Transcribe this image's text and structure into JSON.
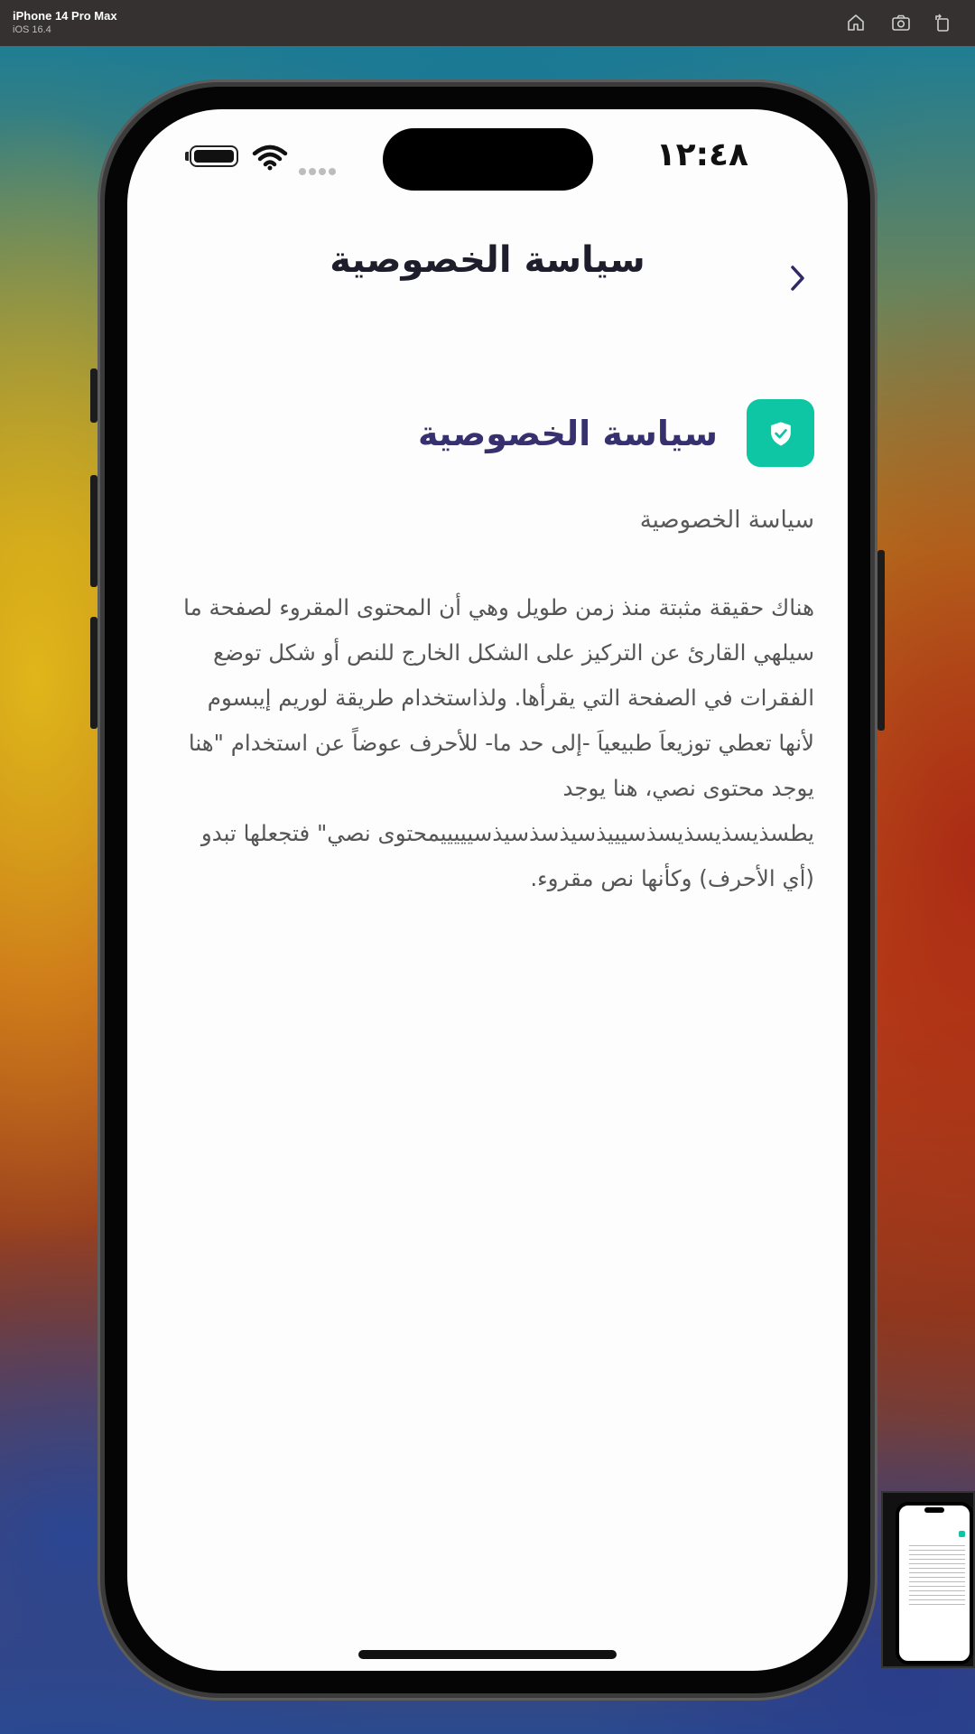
{
  "simulator": {
    "device_name": "iPhone 14 Pro Max",
    "os_version": "iOS 16.4",
    "icons": [
      "home-icon",
      "screenshot-icon",
      "rotate-icon"
    ]
  },
  "status_bar": {
    "time": "١٢:٤٨"
  },
  "nav": {
    "title": "سياسة الخصوصية",
    "back_icon": "chevron-right-icon"
  },
  "content": {
    "section_title": "سياسة الخصوصية",
    "section_icon": "shield-check-icon",
    "subtitle": "سياسة الخصوصية",
    "body": "هناك حقيقة مثبتة منذ زمن طويل وهي أن المحتوى المقروء لصفحة ما سيلهي القارئ عن التركيز على الشكل الخارج للنص أو شكل توضع الفقرات في الصفحة التي يقرأها. ولذاستخدام طريقة لوريم إيبسوم لأنها تعطي توزيعاَ طبيعياَ -إلى حد ما- للأحرف عوضاً عن استخدام \"هنا يوجد محتوى نصي، هنا يوجد يطسذيسذيسذيسذسيييذسيذسذسيذسيييييمحتوى نصي\" فتجعلها تبدو (أي الأحرف) وكأنها نص مقروء."
  },
  "colors": {
    "accent_teal": "#0ec5a4",
    "title_purple": "#36316e",
    "nav_chevron": "#2f2a66"
  }
}
